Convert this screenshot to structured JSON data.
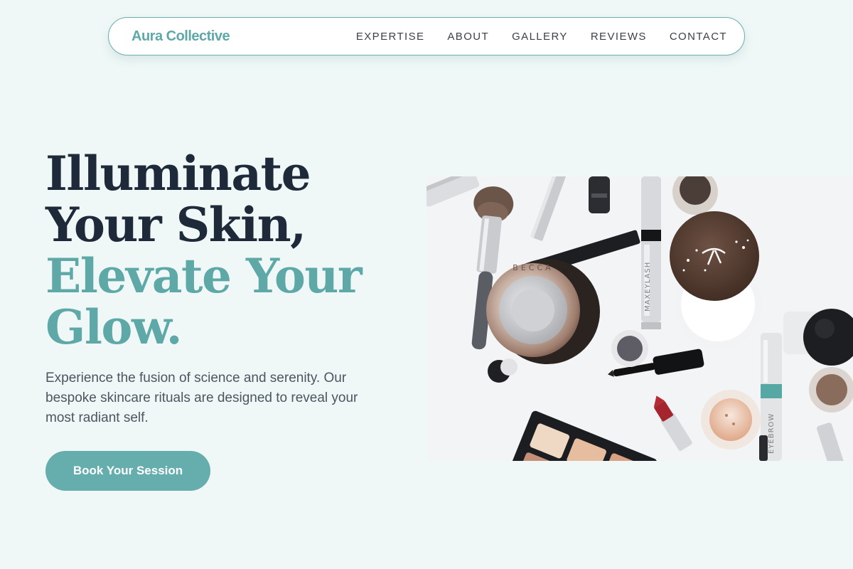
{
  "nav": {
    "brand": "Aura Collective",
    "items": [
      {
        "label": "EXPERTISE"
      },
      {
        "label": "ABOUT"
      },
      {
        "label": "GALLERY"
      },
      {
        "label": "REVIEWS"
      },
      {
        "label": "CONTACT"
      }
    ]
  },
  "hero": {
    "headline_dark_1": "Illuminate",
    "headline_dark_2": "Your Skin,",
    "headline_teal_1": "Elevate Your",
    "headline_teal_2": "Glow.",
    "description": "Experience the fusion of science and serenity. Our bespoke skincare rituals are designed to reveal your most radiant self.",
    "cta_label": "Book Your Session",
    "image_alt": "Flat lay of makeup products: brush, compact, palettes, mascara, lipstick",
    "image_text": {
      "compact_brand": "BECCA",
      "tube_1": "MAXEYLASH",
      "tube_2": "EYEBROW"
    }
  },
  "colors": {
    "background": "#eff8f7",
    "accent": "#5fa8a8",
    "heading_dark": "#1e2a3a",
    "body_text": "#4d5560"
  }
}
